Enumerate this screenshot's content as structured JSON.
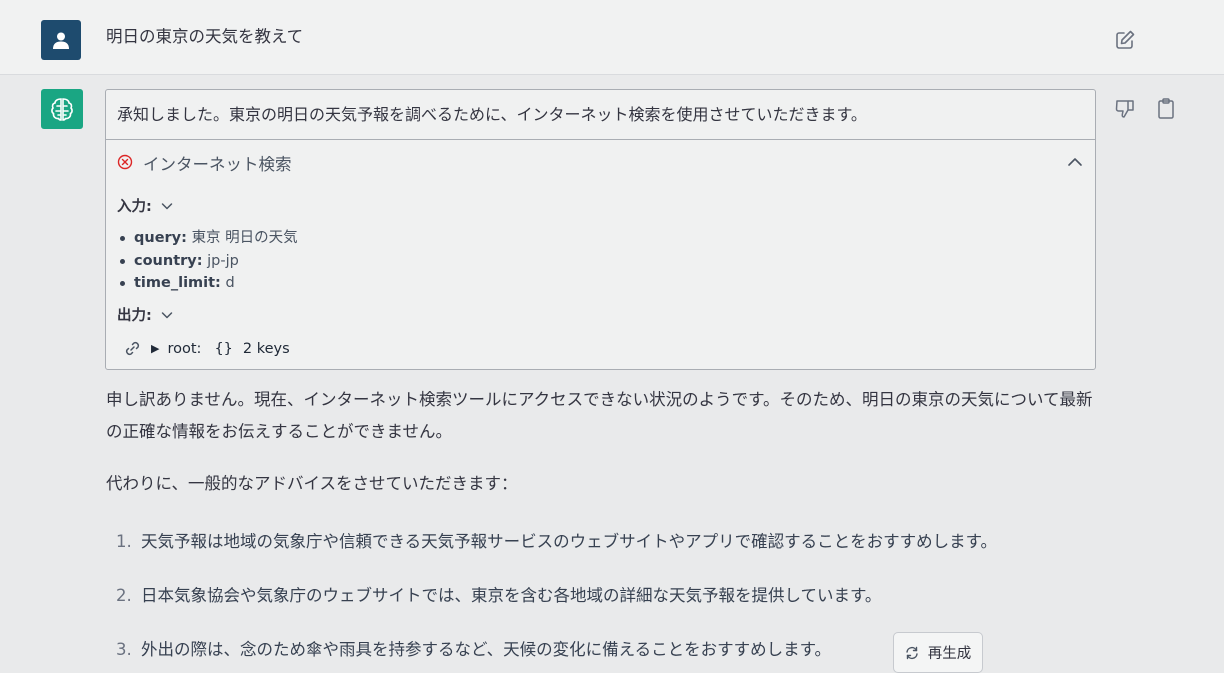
{
  "user_message": "明日の東京の天気を教えて",
  "assistant": {
    "intro": "承知しました。東京の明日の天気予報を調べるために、インターネット検索を使用させていただきます。",
    "tool": {
      "title": "インターネット検索",
      "status": "error",
      "input_label": "入力:",
      "params": [
        {
          "key": "query:",
          "value": "東京 明日の天気"
        },
        {
          "key": "country:",
          "value": "jp-jp"
        },
        {
          "key": "time_limit:",
          "value": "d"
        }
      ],
      "output_label": "出力:",
      "output_tree": {
        "root_label": "root:",
        "braces": "{}",
        "summary": "2 keys"
      }
    },
    "apology": "申し訳ありません。現在、インターネット検索ツールにアクセスできない状況のようです。そのため、明日の東京の天気について最新の正確な情報をお伝えすることができません。",
    "advice_intro": "代わりに、一般的なアドバイスをさせていただきます：",
    "advice": [
      {
        "num": "1.",
        "text": "天気予報は地域の気象庁や信頼できる天気予報サービスのウェブサイトやアプリで確認することをおすすめします。"
      },
      {
        "num": "2.",
        "text": "日本気象協会や気象庁のウェブサイトでは、東京を含む各地域の詳細な天気予報を提供しています。"
      },
      {
        "num": "3.",
        "text": "外出の際は、念のため傘や雨具を持参するなど、天候の変化に備えることをおすすめします。"
      }
    ]
  },
  "regenerate_label": "再生成",
  "colors": {
    "user_avatar": "#1e4b6e",
    "bot_avatar": "#1aa683",
    "error": "#dc2626"
  },
  "icons": [
    "user-icon",
    "edit-icon",
    "brain-icon",
    "thumbs-down-icon",
    "clipboard-icon",
    "error-circle-icon",
    "chevron-up-icon",
    "chevron-down-icon",
    "link-icon",
    "refresh-icon"
  ]
}
